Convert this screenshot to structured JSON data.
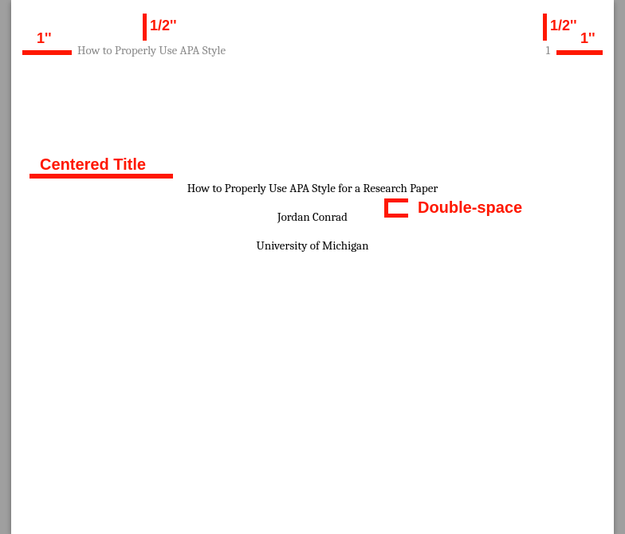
{
  "header": {
    "running_head": "How to Properly Use APA Style",
    "page_number": "1"
  },
  "body": {
    "title": "How to Properly Use APA Style for a Research Paper",
    "author": "Jordan Conrad",
    "affiliation": "University of Michigan"
  },
  "annotations": {
    "left_margin": "1''",
    "left_top_margin": "1/2''",
    "right_top_margin": "1/2''",
    "right_margin": "1''",
    "centered_title": "Centered Title",
    "double_space": "Double-space"
  }
}
